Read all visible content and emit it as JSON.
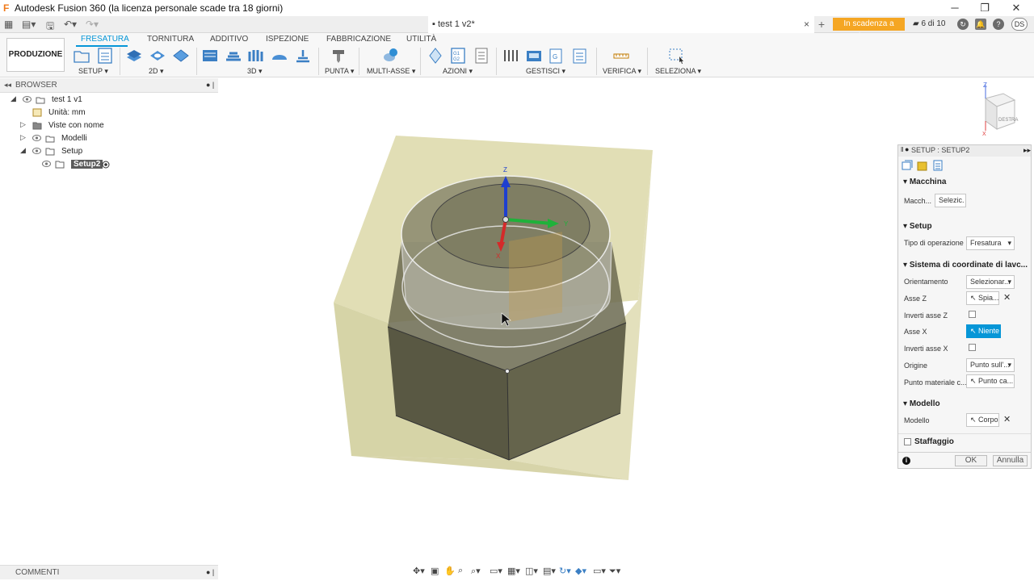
{
  "window": {
    "title": "Autodesk Fusion 360 (la licenza personale scade tra 18 giorni)",
    "logo_letter": "F"
  },
  "doc_tab": {
    "title": "test 1 v2*",
    "close": "×"
  },
  "header_right": {
    "plus": "+",
    "expiring_badge": "In scadenza a breve",
    "jobs": "6 di 10",
    "avatar": "DS"
  },
  "ribbon": {
    "workspace": "PRODUZIONE ▾",
    "tabs": [
      "FRESATURA",
      "TORNITURA",
      "ADDITIVO",
      "ISPEZIONE",
      "FABBRICAZIONE",
      "UTILITÀ"
    ],
    "groups": [
      "SETUP ▾",
      "2D ▾",
      "3D ▾",
      "PUNTA ▾",
      "MULTI-ASSE ▾",
      "AZIONI ▾",
      "GESTISCI ▾",
      "VERIFICA ▾",
      "SELEZIONA ▾"
    ]
  },
  "browser": {
    "title": "BROWSER",
    "items": [
      {
        "label": "test 1 v1"
      },
      {
        "label": "Unità: mm"
      },
      {
        "label": "Viste con nome"
      },
      {
        "label": "Modelli"
      },
      {
        "label": "Setup"
      },
      {
        "label": "Setup2"
      }
    ]
  },
  "comments": {
    "title": "COMMENTI"
  },
  "viewcube": {
    "face": "DESTRA",
    "axis_z": "Z",
    "axis_x": "X"
  },
  "viewport": {
    "axis_z": "Z",
    "axis_y": "Y",
    "axis_x": "X"
  },
  "dialog": {
    "title": "SETUP : SETUP2",
    "sections": {
      "macchina": "Macchina",
      "setup": "Setup",
      "sistema": "Sistema di coordinate di lavc...",
      "modello": "Modello",
      "staffaggio": "Staffaggio"
    },
    "fields": {
      "macchina_label": "Macch...",
      "macchina_value": "Selezic.",
      "tipo_label": "Tipo di operazione",
      "tipo_value": "Fresatura",
      "orientamento_label": "Orientamento",
      "orientamento_value": "Selezionar...",
      "asse_z_label": "Asse Z",
      "asse_z_value": "Spia...",
      "inverti_z_label": "Inverti asse Z",
      "asse_x_label": "Asse X",
      "asse_x_value": "Niente",
      "inverti_x_label": "Inverti asse X",
      "origine_label": "Origine",
      "origine_value": "Punto sull'...",
      "punto_label": "Punto materiale c...",
      "punto_value": "Punto ca...",
      "modello_label": "Modello",
      "modello_value": "Corpo"
    },
    "ok": "OK",
    "cancel": "Annulla"
  }
}
